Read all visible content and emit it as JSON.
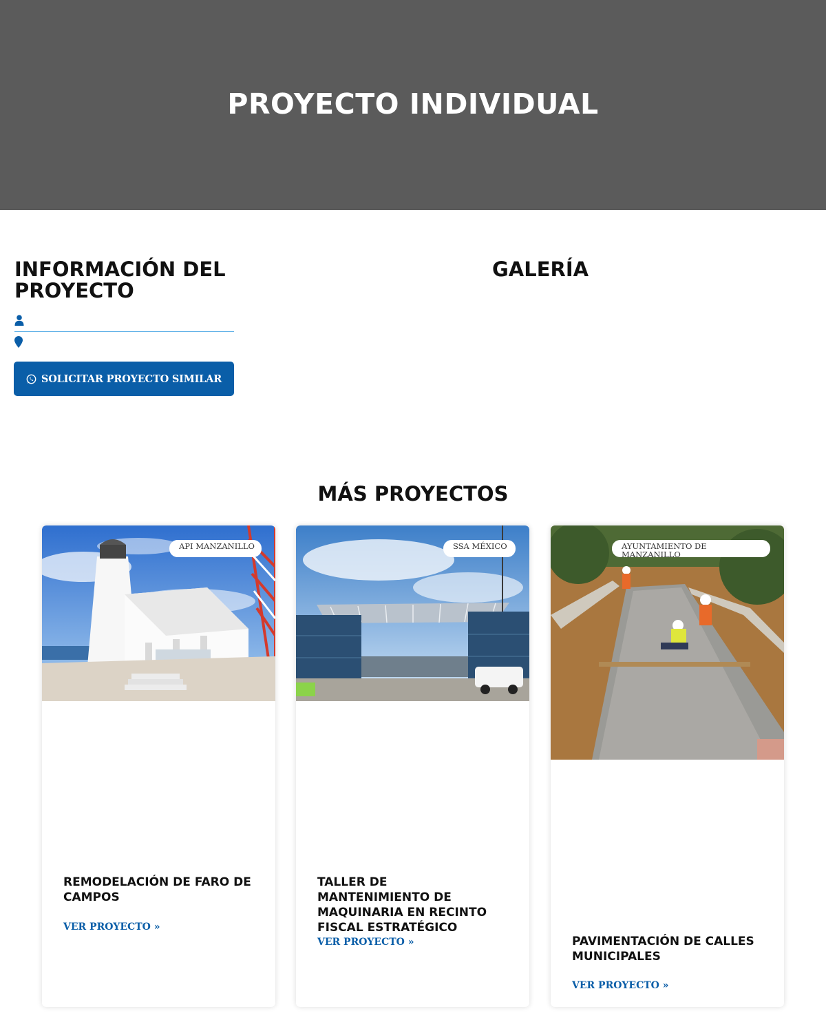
{
  "hero": {
    "title": "PROYECTO INDIVIDUAL"
  },
  "info": {
    "title": "INFORMACIÓN DEL PROYECTO",
    "client_icon": "user-icon",
    "location_icon": "map-marker-icon",
    "cta_label": "SOLICITAR PROYECTO SIMILAR",
    "cta_icon": "whatsapp-icon"
  },
  "gallery": {
    "title": "GALERÍA"
  },
  "more": {
    "title": "MÁS PROYECTOS",
    "cards": [
      {
        "badge": "API MANZANILLO",
        "title": "REMODELACIÓN DE FARO DE CAMPOS",
        "link": "VER PROYECTO »",
        "image": "lighthouse-photo"
      },
      {
        "badge": "SSA MÉXICO",
        "title": "TALLER DE MANTENIMIENTO DE MAQUINARIA EN RECINTO FISCAL ESTRATÉGICO",
        "link": "VER PROYECTO »",
        "image": "container-workshop-photo"
      },
      {
        "badge": "AYUNTAMIENTO DE MANZANILLO",
        "title": "PAVIMENTACIÓN DE CALLES MUNICIPALES",
        "link": "VER PROYECTO »",
        "image": "street-paving-photo"
      }
    ]
  },
  "colors": {
    "hero_bg": "#5b5b5b",
    "accent": "#0a5ea8",
    "divider": "#5aaee6"
  }
}
